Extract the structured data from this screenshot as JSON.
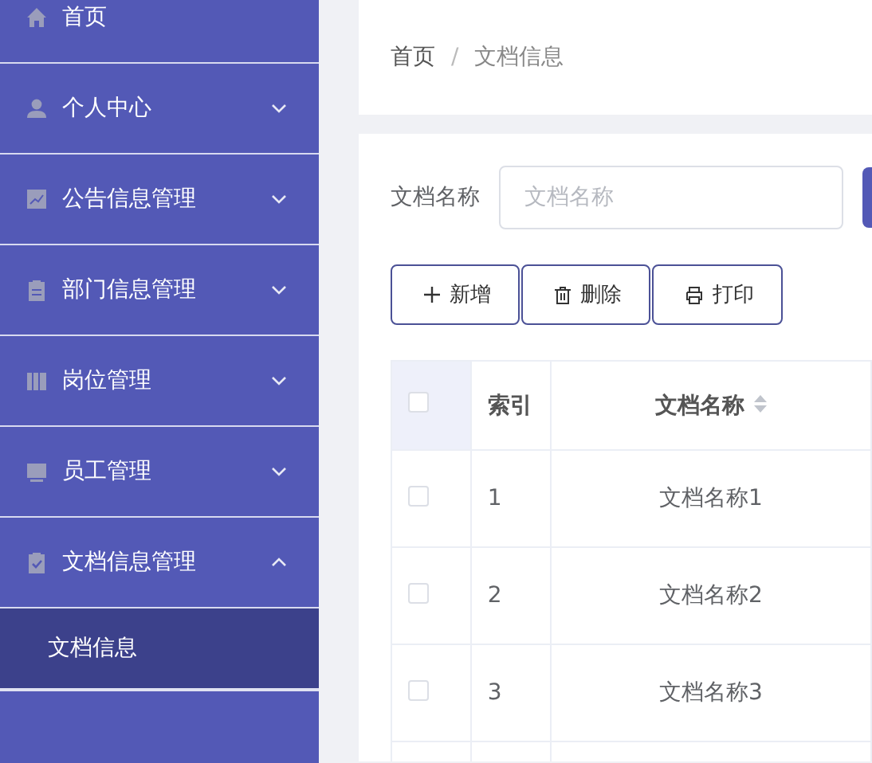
{
  "sidebar": {
    "items": [
      {
        "label": "首页"
      },
      {
        "label": "个人中心",
        "expanded": false
      },
      {
        "label": "公告信息管理",
        "expanded": false
      },
      {
        "label": "部门信息管理",
        "expanded": false
      },
      {
        "label": "岗位管理",
        "expanded": false
      },
      {
        "label": "员工管理",
        "expanded": false
      },
      {
        "label": "文档信息管理",
        "expanded": true,
        "children": [
          {
            "label": "文档信息",
            "selected": true
          }
        ]
      }
    ]
  },
  "breadcrumb": {
    "items": [
      "首页",
      "文档信息"
    ],
    "separator": "/"
  },
  "search": {
    "label": "文档名称",
    "placeholder": "文档名称"
  },
  "buttons": [
    {
      "label": "新增"
    },
    {
      "label": "删除"
    },
    {
      "label": "打印"
    }
  ],
  "table": {
    "header_checked": false,
    "columns": [
      {
        "label": "索引"
      },
      {
        "label": "文档名称"
      }
    ],
    "rows": [
      {
        "checked": false,
        "cells": [
          "1",
          "文档名称1"
        ]
      },
      {
        "checked": false,
        "cells": [
          "2",
          "文档名称2"
        ]
      },
      {
        "checked": false,
        "cells": [
          "3",
          "文档名称3"
        ]
      }
    ]
  }
}
